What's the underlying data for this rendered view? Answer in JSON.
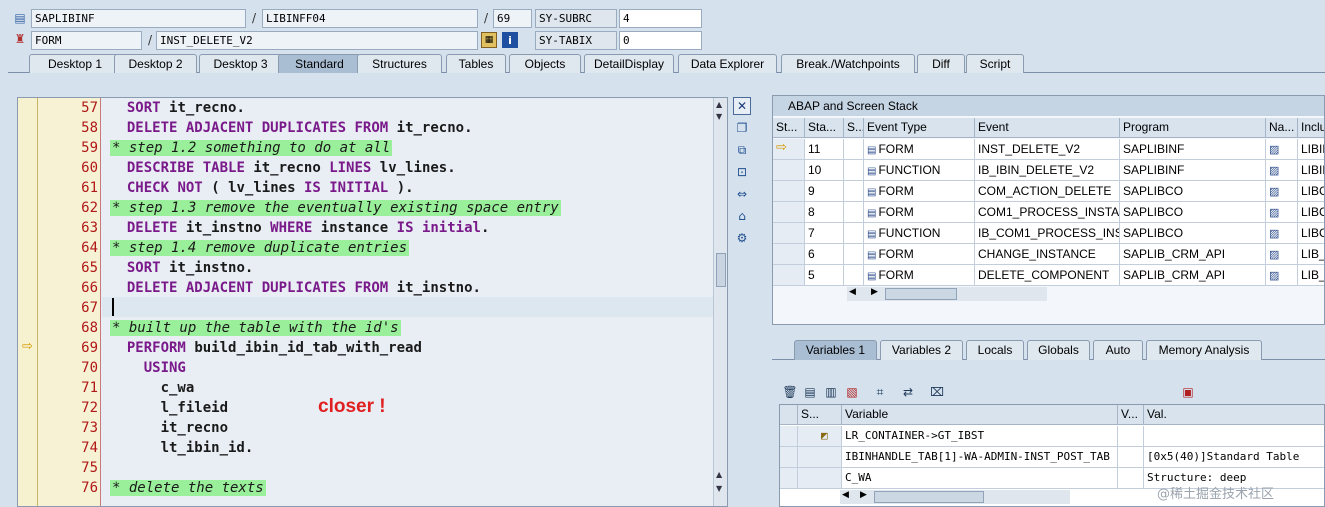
{
  "top": {
    "program_field": "SAPLIBINF",
    "include_field": "LIBINFF04",
    "line_field": "69",
    "subrc_label": "SY-SUBRC",
    "subrc_value": "4",
    "event_type_field": "FORM",
    "event_field": "INST_DELETE_V2",
    "tabix_label": "SY-TABIX",
    "tabix_value": "0"
  },
  "tabs": [
    {
      "label": "Desktop 1"
    },
    {
      "label": "Desktop 2"
    },
    {
      "label": "Desktop 3"
    },
    {
      "label": "Standard"
    },
    {
      "label": "Structures"
    },
    {
      "label": "Tables"
    },
    {
      "label": "Objects"
    },
    {
      "label": "DetailDisplay"
    },
    {
      "label": "Data Explorer"
    },
    {
      "label": "Break./Watchpoints"
    },
    {
      "label": "Diff"
    },
    {
      "label": "Script"
    }
  ],
  "active_tab": "Standard",
  "code": {
    "lines": [
      {
        "n": "57",
        "text": "  SORT it_recno."
      },
      {
        "n": "58",
        "text": "  DELETE ADJACENT DUPLICATES FROM it_recno."
      },
      {
        "n": "59",
        "text": "* step 1.2 something to do at all"
      },
      {
        "n": "60",
        "text": "  DESCRIBE TABLE it_recno LINES lv_lines."
      },
      {
        "n": "61",
        "text": "  CHECK NOT ( lv_lines IS INITIAL )."
      },
      {
        "n": "62",
        "text": "* step 1.3 remove the eventually existing space entry"
      },
      {
        "n": "63",
        "text": "  DELETE it_instno WHERE instance IS initial."
      },
      {
        "n": "64",
        "text": "* step 1.4 remove duplicate entries"
      },
      {
        "n": "65",
        "text": "  SORT it_instno."
      },
      {
        "n": "66",
        "text": "  DELETE ADJACENT DUPLICATES FROM it_instno."
      },
      {
        "n": "67",
        "text": ""
      },
      {
        "n": "68",
        "text": "* built up the table with the id's"
      },
      {
        "n": "69",
        "text": "  PERFORM build_ibin_id_tab_with_read"
      },
      {
        "n": "70",
        "text": "    USING"
      },
      {
        "n": "71",
        "text": "      c_wa"
      },
      {
        "n": "72",
        "text": "      l_fileid"
      },
      {
        "n": "73",
        "text": "      it_recno"
      },
      {
        "n": "74",
        "text": "      lt_ibin_id."
      },
      {
        "n": "75",
        "text": ""
      },
      {
        "n": "76",
        "text": "* delete the texts"
      }
    ],
    "annotation": "closer !"
  },
  "stack": {
    "title": "ABAP and Screen Stack",
    "columns": [
      "St...",
      "Sta...",
      "S...",
      "Event Type",
      "Event",
      "Program",
      "Na...",
      "Inclu"
    ],
    "rows": [
      {
        "level": "11",
        "event_type": "FORM",
        "event": "INST_DELETE_V2",
        "program": "SAPLIBINF",
        "include": "LIBIN",
        "current": true
      },
      {
        "level": "10",
        "event_type": "FUNCTION",
        "event": "IB_IBIN_DELETE_V2",
        "program": "SAPLIBINF",
        "include": "LIBIN",
        "current": false
      },
      {
        "level": "9",
        "event_type": "FORM",
        "event": "COM_ACTION_DELETE",
        "program": "SAPLIBCO",
        "include": "LIBCO",
        "current": false
      },
      {
        "level": "8",
        "event_type": "FORM",
        "event": "COM1_PROCESS_INSTA...",
        "program": "SAPLIBCO",
        "include": "LIBCO",
        "current": false
      },
      {
        "level": "7",
        "event_type": "FUNCTION",
        "event": "IB_COM1_PROCESS_INS...",
        "program": "SAPLIBCO",
        "include": "LIBCO",
        "current": false
      },
      {
        "level": "6",
        "event_type": "FORM",
        "event": "CHANGE_INSTANCE",
        "program": "SAPLIB_CRM_API",
        "include": "LIB_C",
        "current": false
      },
      {
        "level": "5",
        "event_type": "FORM",
        "event": "DELETE_COMPONENT",
        "program": "SAPLIB_CRM_API",
        "include": "LIB_C",
        "current": false
      }
    ]
  },
  "var_tabs": [
    {
      "label": "Variables 1"
    },
    {
      "label": "Variables 2"
    },
    {
      "label": "Locals"
    },
    {
      "label": "Globals"
    },
    {
      "label": "Auto"
    },
    {
      "label": "Memory Analysis"
    }
  ],
  "vars": {
    "columns": [
      "S...",
      "Variable",
      "V...",
      "Val."
    ],
    "rows": [
      {
        "variable": "LR_CONTAINER->GT_IBST",
        "value": ""
      },
      {
        "variable": "IBINHANDLE_TAB[1]-WA-ADMIN-INST_POST_TAB",
        "value": "[0x5(40)]Standard Table"
      },
      {
        "variable": "C_WA",
        "value": "Structure: deep"
      }
    ]
  },
  "watermark": "@稀土掘金技术社区"
}
